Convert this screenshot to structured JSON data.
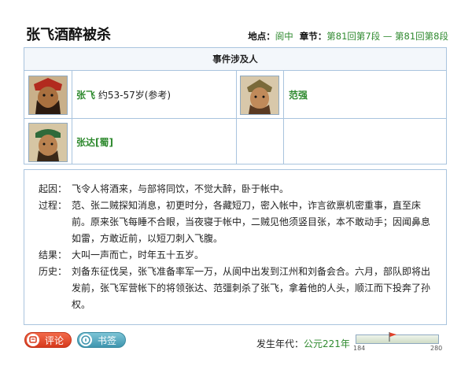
{
  "header": {
    "title": "张飞酒醉被杀",
    "location_label": "地点：",
    "location_value": "阆中",
    "chapter_label": "章节：",
    "chapter_value": "第81回第7段 — 第81回第8段"
  },
  "persons": {
    "heading": "事件涉及人",
    "items": [
      {
        "name": "张飞",
        "note": "约53-57岁(参考)",
        "icon": "zhangfei-portrait-icon"
      },
      {
        "name": "范强",
        "note": "",
        "icon": "fanqiang-portrait-icon"
      },
      {
        "name": "张达[蜀]",
        "note": "",
        "icon": "zhangda-portrait-icon"
      }
    ]
  },
  "story": {
    "rows": [
      {
        "key": "起因：",
        "text": "飞令人将酒来，与部将同饮，不觉大醉，卧于帐中。"
      },
      {
        "key": "过程：",
        "text": "范、张二贼探知消息，初更时分，各藏短刀，密入帐中，诈言欲禀机密重事，直至床前。原来张飞每睡不合眼，当夜寝于帐中，二贼见他须竖目张，本不敢动手；因闻鼻息如雷，方敢近前，以短刀刺入飞腹。"
      },
      {
        "key": "结果：",
        "text": "大叫一声而亡，时年五十五岁。"
      },
      {
        "key": "历史：",
        "text": "刘备东征伐吴，张飞准备率军一万，从阆中出发到江州和刘备会合。六月，部队即将出发前，张飞军营帐下的将领张达、范彊刺杀了张飞，拿着他的人头，顺江而下投奔了孙权。"
      }
    ]
  },
  "footer": {
    "comment_label": "评论",
    "bookmark_label": "书签",
    "era_label": "发生年代：",
    "era_value": "公元221年",
    "slider_min": "184",
    "slider_max": "280",
    "slider_value": 221,
    "colors": {
      "accent_green": "#2f8a2f",
      "border_blue": "#a9c4de",
      "comment_red": "#d6391c",
      "bookmark_teal": "#3f95ae"
    }
  }
}
